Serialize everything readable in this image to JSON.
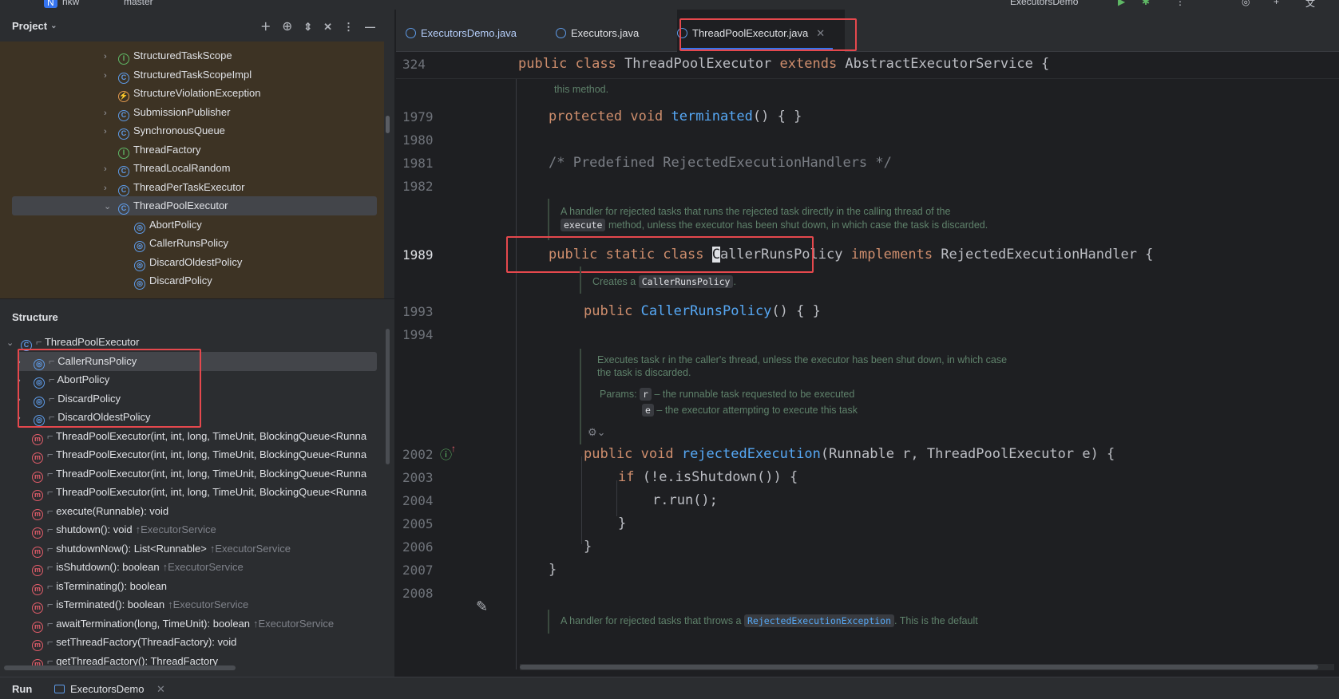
{
  "topbar": {
    "project_badge": "N",
    "project": "nkw",
    "branch": "master",
    "run_config": "ExecutorsDemo"
  },
  "project_panel": {
    "title": "Project",
    "items": [
      {
        "label": "StructuredTaskScope",
        "icon": "interface-icon"
      },
      {
        "label": "StructuredTaskScopeImpl",
        "icon": "class-icon"
      },
      {
        "label": "StructureViolationException",
        "icon": "exception-icon"
      },
      {
        "label": "SubmissionPublisher",
        "icon": "class-icon"
      },
      {
        "label": "SynchronousQueue",
        "icon": "class-icon"
      },
      {
        "label": "ThreadFactory",
        "icon": "interface-icon"
      },
      {
        "label": "ThreadLocalRandom",
        "icon": "class-icon"
      },
      {
        "label": "ThreadPerTaskExecutor",
        "icon": "class-icon"
      },
      {
        "label": "ThreadPoolExecutor",
        "icon": "class-icon"
      },
      {
        "label": "AbortPolicy",
        "icon": "inner-class-icon"
      },
      {
        "label": "CallerRunsPolicy",
        "icon": "inner-class-icon"
      },
      {
        "label": "DiscardOldestPolicy",
        "icon": "inner-class-icon"
      },
      {
        "label": "DiscardPolicy",
        "icon": "inner-class-icon"
      }
    ]
  },
  "structure_panel": {
    "title": "Structure",
    "root": "ThreadPoolExecutor",
    "items": [
      {
        "label": "CallerRunsPolicy",
        "suffix": ""
      },
      {
        "label": "AbortPolicy",
        "suffix": ""
      },
      {
        "label": "DiscardPolicy",
        "suffix": ""
      },
      {
        "label": "DiscardOldestPolicy",
        "suffix": ""
      },
      {
        "label": "ThreadPoolExecutor(int, int, long, TimeUnit, BlockingQueue<Runna",
        "suffix": ""
      },
      {
        "label": "ThreadPoolExecutor(int, int, long, TimeUnit, BlockingQueue<Runna",
        "suffix": ""
      },
      {
        "label": "ThreadPoolExecutor(int, int, long, TimeUnit, BlockingQueue<Runna",
        "suffix": ""
      },
      {
        "label": "ThreadPoolExecutor(int, int, long, TimeUnit, BlockingQueue<Runna",
        "suffix": ""
      },
      {
        "label": "execute(Runnable): void",
        "suffix": ""
      },
      {
        "label": "shutdown(): void",
        "suffix": "↑ExecutorService"
      },
      {
        "label": "shutdownNow(): List<Runnable>",
        "suffix": "↑ExecutorService"
      },
      {
        "label": "isShutdown(): boolean",
        "suffix": "↑ExecutorService"
      },
      {
        "label": "isTerminating(): boolean",
        "suffix": ""
      },
      {
        "label": "isTerminated(): boolean",
        "suffix": "↑ExecutorService"
      },
      {
        "label": "awaitTermination(long, TimeUnit): boolean",
        "suffix": "↑ExecutorService"
      },
      {
        "label": "setThreadFactory(ThreadFactory): void",
        "suffix": ""
      },
      {
        "label": "getThreadFactory(): ThreadFactory",
        "suffix": ""
      }
    ]
  },
  "tabs": [
    "ExecutorsDemo.java",
    "Executors.java",
    "ThreadPoolExecutor.java"
  ],
  "editor": {
    "sticky_line": "324",
    "sticky_code": "public class ThreadPoolExecutor extends AbstractExecutorService {",
    "doc_top": "this method.",
    "lines": {
      "l1979": "1979",
      "l1980": "1980",
      "l1981": "1981",
      "l1982": "1982",
      "l1989": "1989",
      "l1993": "1993",
      "l1994": "1994",
      "l2002": "2002",
      "l2003": "2003",
      "l2004": "2004",
      "l2005": "2005",
      "l2006": "2006",
      "l2007": "2007",
      "l2008": "2008"
    },
    "comment_predef": "/* Predefined RejectedExecutionHandlers */",
    "doc_handler_1": "A handler for rejected tasks that runs the rejected task directly in the calling thread of the",
    "doc_handler_2_code": "execute",
    "doc_handler_2": " method, unless the executor has been shut down, in which case the task is discarded.",
    "doc_creates": "Creates a",
    "doc_creates_code": "CallerRunsPolicy",
    "doc_exec_1": "Executes task r in the caller's thread, unless the executor has been shut down, in which case",
    "doc_exec_2": "the task is discarded.",
    "doc_params": "Params:",
    "doc_param_r": "r",
    "doc_param_r_text": "– the runnable task requested to be executed",
    "doc_param_e": "e",
    "doc_param_e_text": "– the executor attempting to execute this task",
    "doc_bottom_1": "A handler for rejected tasks that throws a",
    "doc_bottom_code": "RejectedExecutionException",
    "doc_bottom_2": ". This is the default"
  },
  "statusbar": {
    "run_label": "Run",
    "run_tab": "ExecutorsDemo"
  }
}
